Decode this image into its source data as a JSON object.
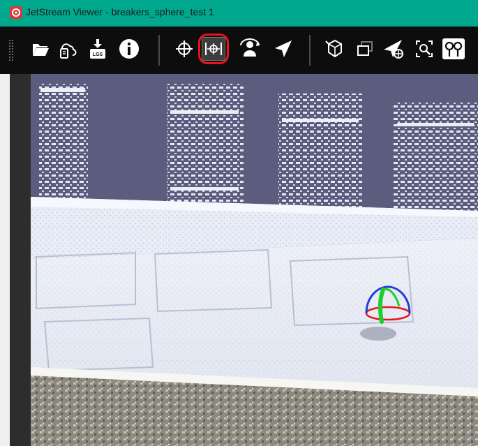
{
  "app": {
    "window_title": "JetStream Viewer - breakers_sphere_test 1",
    "app_icon": "jetstream-logo-icon"
  },
  "toolbar": {
    "buttons": [
      {
        "name": "open-folder-icon",
        "label": "Open"
      },
      {
        "name": "cloud-connect-icon",
        "label": "Cloud"
      },
      {
        "name": "lgs-export-icon",
        "label": "LGS"
      },
      {
        "name": "info-icon",
        "label": "Info"
      },
      {
        "name": "orbit-icon",
        "label": "Orbit"
      },
      {
        "name": "fit-view-icon",
        "label": "Fit"
      },
      {
        "name": "walk-mode-icon",
        "label": "Walk"
      },
      {
        "name": "navigate-arrow-icon",
        "label": "Navigate"
      },
      {
        "name": "cube-view-icon",
        "label": "Cube"
      },
      {
        "name": "window-view-icon",
        "label": "Window"
      },
      {
        "name": "measure-target-icon",
        "label": "Measure"
      },
      {
        "name": "zoom-box-icon",
        "label": "Zoom"
      },
      {
        "name": "setup-pair-icon",
        "label": "Setups"
      }
    ],
    "highlighted": "fit-view-icon"
  },
  "colors": {
    "titlebar": "#00a88e",
    "toolbar_bg": "#0d0d0d",
    "highlight": "#e8141e",
    "sky": "#5c5d7e"
  },
  "viewport": {
    "content": "point cloud",
    "gizmo": "sphere-gizmo-icon"
  }
}
